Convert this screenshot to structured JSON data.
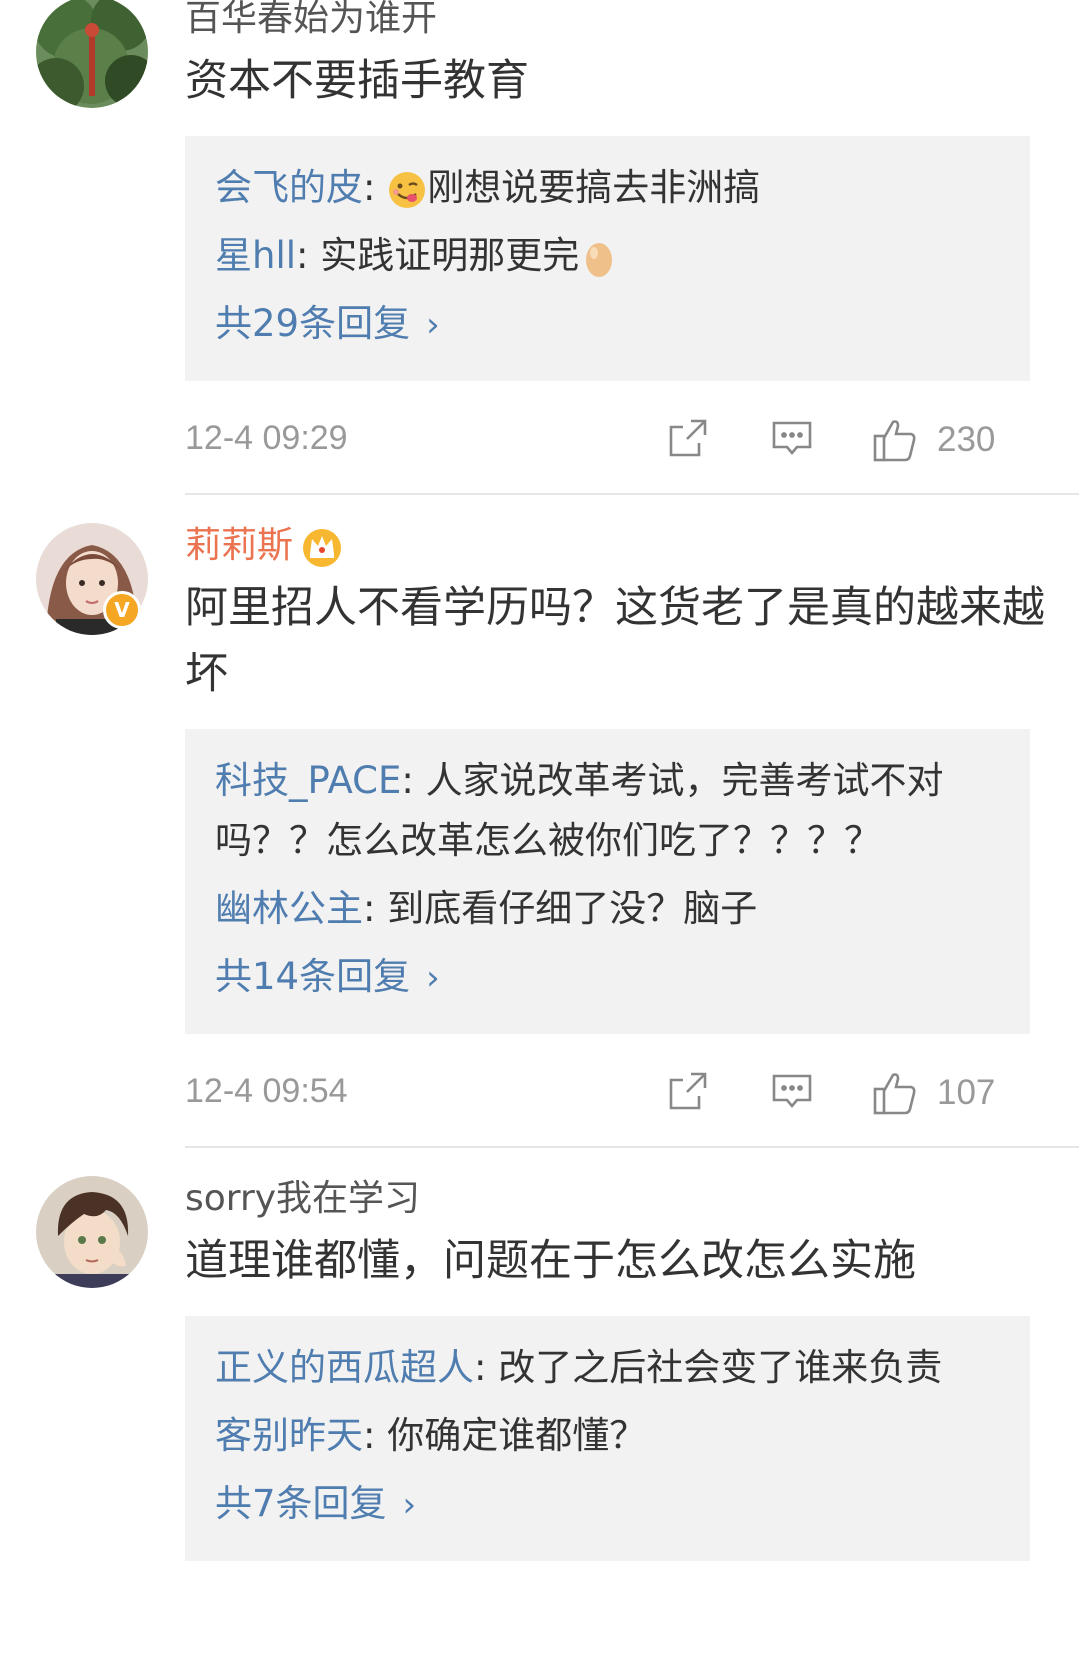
{
  "comments": [
    {
      "username": "百华春始为谁开",
      "text": "资本不要插手教育",
      "replies": [
        {
          "name": "会飞的皮",
          "text": "刚想说要搞去非洲搞",
          "emoji_before": "face-savoring-emoji"
        },
        {
          "name": "星hll",
          "text": "实践证明那更完",
          "emoji_after": "egg-emoji"
        }
      ],
      "more_label": "共29条回复",
      "time": "12-4 09:29",
      "likes": "230"
    },
    {
      "username": "莉莉斯",
      "vip": true,
      "verified": true,
      "text": "阿里招人不看学历吗？这货老了是真的越来越坏",
      "replies": [
        {
          "name": "科技_PACE",
          "text": "人家说改革考试，完善考试不对吗？？怎么改革怎么被你们吃了？？？？"
        },
        {
          "name": "幽林公主",
          "text": "到底看仔细了没？脑子"
        }
      ],
      "more_label": "共14条回复",
      "time": "12-4 09:54",
      "likes": "107"
    },
    {
      "username": "sorry我在学习",
      "text": "道理谁都懂，问题在于怎么改怎么实施",
      "replies": [
        {
          "name": "正义的西瓜超人",
          "text": "改了之后社会变了谁来负责"
        },
        {
          "name": "客别昨天",
          "text": "你确定谁都懂？"
        }
      ],
      "more_label": "共7条回复"
    }
  ],
  "icons": {
    "share": "share-icon",
    "comment": "comment-icon",
    "like": "like-icon",
    "more_chevron": "›"
  },
  "colors": {
    "link": "#507daf",
    "vip_name": "#eb7350",
    "reply_bg": "#f2f2f2",
    "meta": "#999999"
  }
}
